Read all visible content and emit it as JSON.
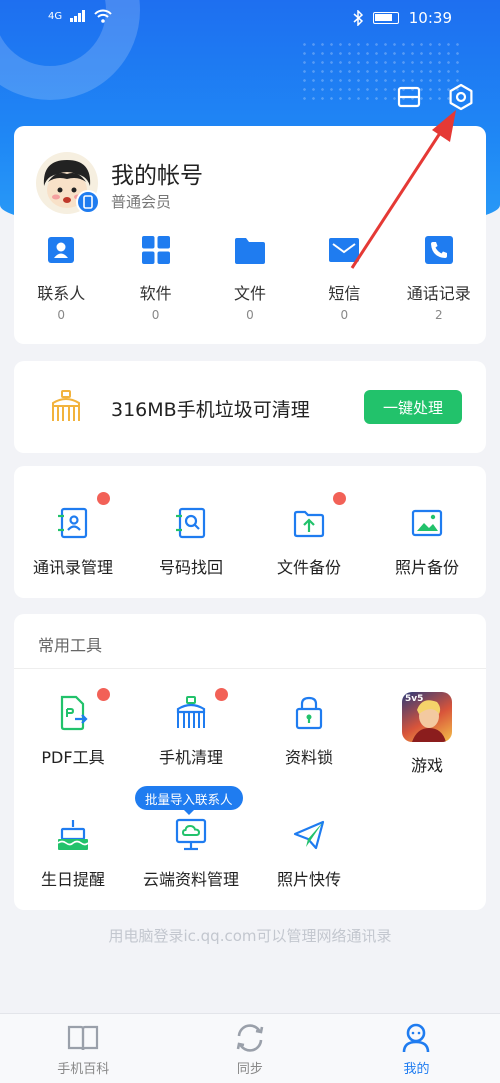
{
  "status_bar": {
    "signal": "4G",
    "time": "10:39"
  },
  "account": {
    "name": "我的帐号",
    "level": "普通会员",
    "stats": [
      {
        "icon": "contacts-icon",
        "label": "联系人",
        "count": "0"
      },
      {
        "icon": "apps-grid-icon",
        "label": "软件",
        "count": "0"
      },
      {
        "icon": "folder-icon",
        "label": "文件",
        "count": "0"
      },
      {
        "icon": "mail-icon",
        "label": "短信",
        "count": "0"
      },
      {
        "icon": "phone-icon",
        "label": "通话记录",
        "count": "2"
      }
    ]
  },
  "clean": {
    "text": "316MB手机垃圾可清理",
    "button": "一键处理"
  },
  "quick": [
    {
      "label": "通讯录管理",
      "badge": true
    },
    {
      "label": "号码找回",
      "badge": false
    },
    {
      "label": "文件备份",
      "badge": true
    },
    {
      "label": "照片备份",
      "badge": false
    }
  ],
  "tools": {
    "title": "常用工具",
    "items": [
      {
        "label": "PDF工具",
        "badge": true
      },
      {
        "label": "手机清理",
        "badge": true
      },
      {
        "label": "资料锁",
        "badge": false
      },
      {
        "label": "游戏",
        "badge": false,
        "icon_text": "5v5"
      },
      {
        "label": "生日提醒",
        "badge": false
      },
      {
        "label": "云端资料管理",
        "badge": false
      },
      {
        "label": "照片快传",
        "badge": false
      }
    ],
    "tooltip": "批量导入联系人"
  },
  "footer_note": "用电脑登录ic.qq.com可以管理网络通讯录",
  "tabs": [
    {
      "label": "手机百科",
      "active": false
    },
    {
      "label": "同步",
      "active": false
    },
    {
      "label": "我的",
      "active": true
    }
  ],
  "colors": {
    "primary": "#1f7cf0",
    "green": "#22c26b",
    "badge": "#f26157",
    "annotation": "#e53935"
  }
}
